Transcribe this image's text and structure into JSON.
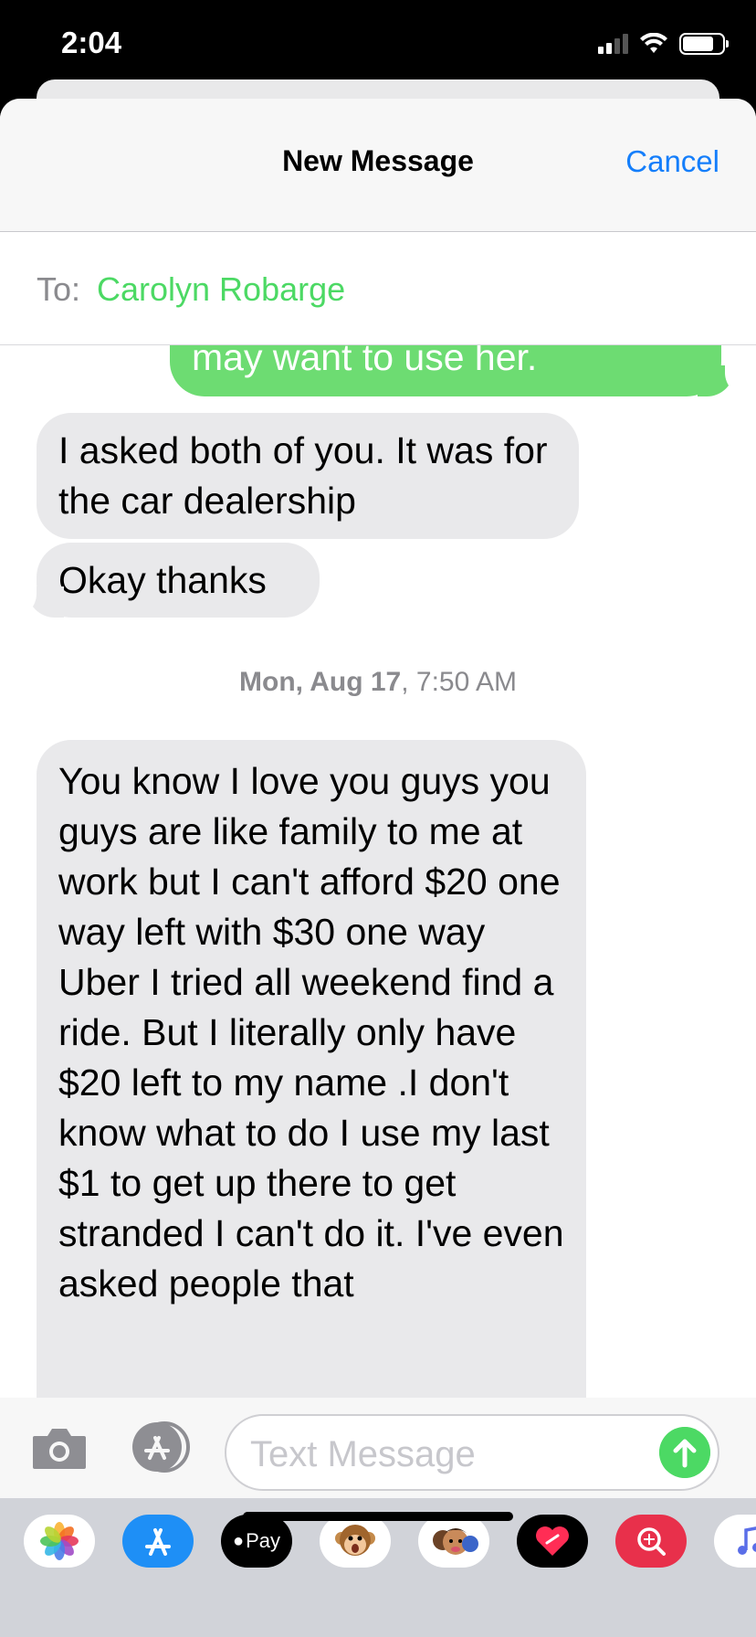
{
  "status_bar": {
    "time": "2:04"
  },
  "nav": {
    "title": "New Message",
    "cancel_label": "Cancel"
  },
  "recipient": {
    "label": "To:",
    "name": "Carolyn Robarge"
  },
  "messages": [
    {
      "direction": "sent",
      "text": "may want to use her."
    },
    {
      "direction": "received",
      "text": "I asked both of you. It was for the car dealership"
    },
    {
      "direction": "received",
      "text": "Okay thanks"
    },
    {
      "direction": "received",
      "text": "You know I love you guys you guys are like family to me at work but I can't afford $20 one way left with $30 one way Uber I tried all weekend find a ride. But I literally only have $20 left to my name .I don't know what to do I use my last $1 to get up there to get stranded I can't do it. I've even asked people that"
    }
  ],
  "timestamp": {
    "date": "Mon, Aug 17",
    "time": ", 7:50 AM"
  },
  "compose": {
    "placeholder": "Text Message"
  },
  "app_drawer": {
    "items": [
      {
        "name": "photos-app-icon"
      },
      {
        "name": "app-store-app-icon"
      },
      {
        "name": "apple-pay-app-icon",
        "label": "Pay"
      },
      {
        "name": "animoji-app-icon"
      },
      {
        "name": "memoji-app-icon"
      },
      {
        "name": "digital-touch-app-icon"
      },
      {
        "name": "images-search-app-icon"
      },
      {
        "name": "music-app-icon"
      }
    ]
  },
  "colors": {
    "sent_bubble": "#6ddc72",
    "received_bubble": "#e9e9eb",
    "link_blue": "#147efb",
    "contact_green": "#4cd964"
  }
}
